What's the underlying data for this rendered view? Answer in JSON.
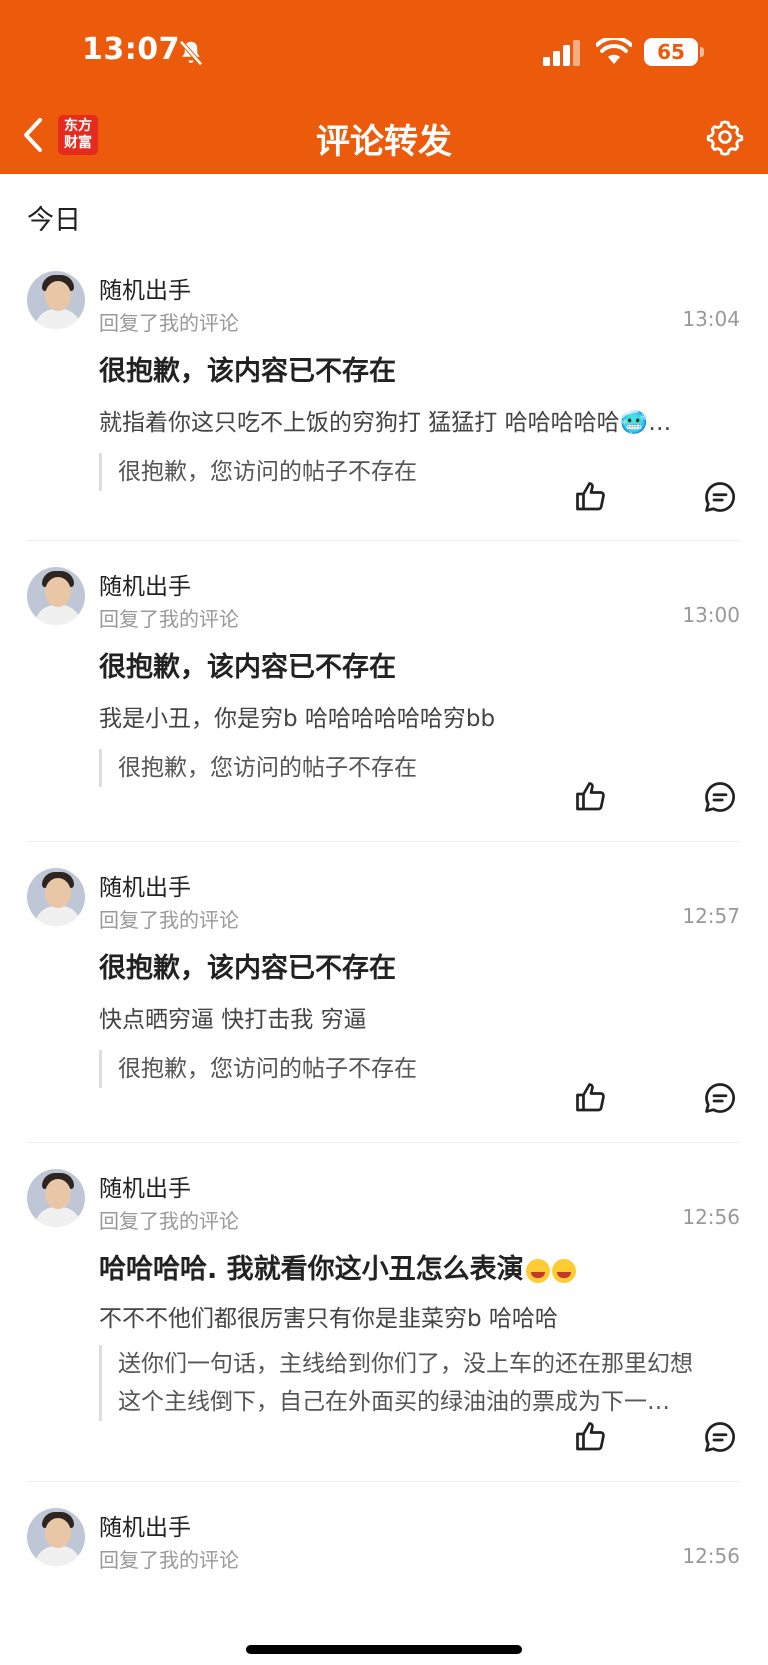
{
  "status_bar": {
    "time": "13:07",
    "battery": "65"
  },
  "nav": {
    "logo_line1": "东方",
    "logo_line2": "财富",
    "title": "评论转发"
  },
  "section_title": "今日",
  "items": [
    {
      "name": "随机出手",
      "action": "回复了我的评论",
      "time": "13:04",
      "headline": "很抱歉，该内容已不存在",
      "body": "就指着你这只吃不上饭的穷狗打 猛猛打 哈哈哈哈哈🥶…",
      "quote": "很抱歉，您访问的帖子不存在"
    },
    {
      "name": "随机出手",
      "action": "回复了我的评论",
      "time": "13:00",
      "headline": "很抱歉，该内容已不存在",
      "body": "我是小丑，你是穷b 哈哈哈哈哈哈穷bb",
      "quote": "很抱歉，您访问的帖子不存在"
    },
    {
      "name": "随机出手",
      "action": "回复了我的评论",
      "time": "12:57",
      "headline": "很抱歉，该内容已不存在",
      "body": "快点晒穷逼 快打击我 穷逼",
      "quote": "很抱歉，您访问的帖子不存在"
    },
    {
      "name": "随机出手",
      "action": "回复了我的评论",
      "time": "12:56",
      "headline": "哈哈哈哈. 我就看你这小丑怎么表演",
      "body": "不不不他们都很厉害只有你是韭菜穷b 哈哈哈",
      "quote": "送你们一句话，主线给到你们了，没上车的还在那里幻想这个主线倒下，自己在外面买的绿油油的票成为下一…"
    },
    {
      "name": "随机出手",
      "action": "回复了我的评论",
      "time": "12:56"
    }
  ],
  "colors": {
    "header_bg": "#EC5A0C",
    "logo_bg": "#E62A1E"
  },
  "icons": {
    "back": "chevron-left-icon",
    "settings": "gear-icon",
    "like": "thumbs-up-icon",
    "reply": "comment-bubble-icon",
    "mute": "bell-slash-icon"
  }
}
